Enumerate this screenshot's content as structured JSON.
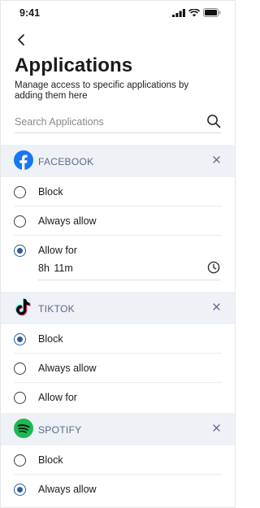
{
  "status_bar": {
    "time": "9:41"
  },
  "header": {
    "title": "Applications",
    "subtitle": "Manage access to specific applications by adding them here"
  },
  "search": {
    "placeholder": "Search Applications",
    "value": ""
  },
  "apps": [
    {
      "name": "FACEBOOK",
      "icon": "facebook-logo",
      "color": "#1877F2",
      "options": [
        {
          "label": "Block",
          "selected": false
        },
        {
          "label": "Always allow",
          "selected": false
        },
        {
          "label": "Allow for",
          "selected": true
        }
      ],
      "allow_for_duration": "8h 11m"
    },
    {
      "name": "TIKTOK",
      "icon": "tiktok-logo",
      "color": "#000000",
      "options": [
        {
          "label": "Block",
          "selected": true
        },
        {
          "label": "Always allow",
          "selected": false
        },
        {
          "label": "Allow for",
          "selected": false
        }
      ]
    },
    {
      "name": "SPOTIFY",
      "icon": "spotify-logo",
      "color": "#1DB954",
      "options": [
        {
          "label": "Block",
          "selected": false
        },
        {
          "label": "Always allow",
          "selected": true
        }
      ]
    }
  ],
  "colors": {
    "accent": "#2F5A9E",
    "section_bg": "#EEF1F6",
    "section_text": "#5A6B86"
  }
}
